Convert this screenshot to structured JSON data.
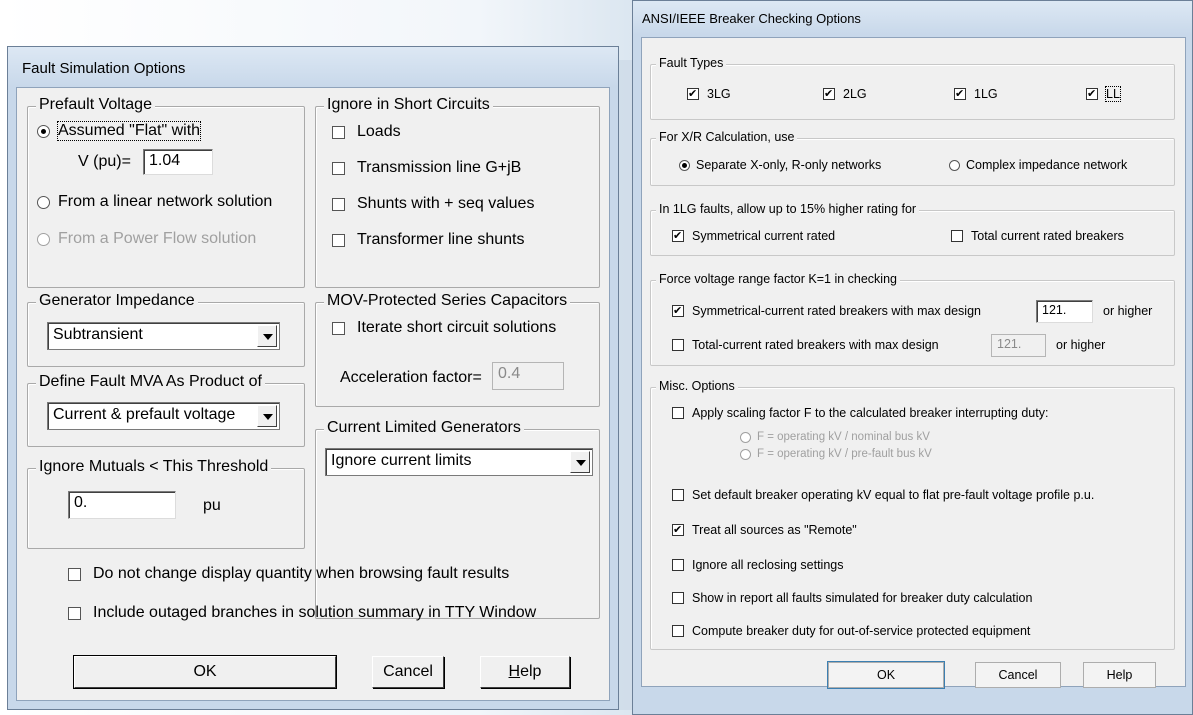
{
  "fault_sim": {
    "title": "Fault Simulation Options",
    "prefault": {
      "group": "Prefault Voltage",
      "assumed_flat": "Assumed \"Flat\" with",
      "vpu_label": "V (pu)=",
      "vpu_value": "1.04",
      "linear": "From a linear network solution",
      "powerflow": "From a Power Flow solution"
    },
    "ignore_sc": {
      "group": "Ignore in Short Circuits",
      "loads": "Loads",
      "trans_line": "Transmission line G+jB",
      "shunts": "Shunts with + seq values",
      "xfmr_shunts": "Transformer line shunts"
    },
    "gen_imp": {
      "group": "Generator Impedance",
      "value": "Subtransient"
    },
    "mov": {
      "group": "MOV-Protected Series Capacitors",
      "iterate": "Iterate short circuit solutions",
      "accel_label": "Acceleration factor=",
      "accel_value": "0.4"
    },
    "fault_mva": {
      "group": "Define Fault MVA As Product of",
      "value": "Current & prefault voltage"
    },
    "cur_lim": {
      "group": "Current Limited Generators",
      "value": "Ignore current limits"
    },
    "mutuals": {
      "group": "Ignore Mutuals < This Threshold",
      "value": "0.",
      "unit": "pu"
    },
    "no_change_display": "Do not change display quantity when browsing fault results",
    "include_outaged": "Include outaged branches in solution summary in TTY Window",
    "buttons": {
      "ok": "OK",
      "cancel": "Cancel",
      "help_h": "H",
      "help_rest": "elp"
    }
  },
  "breaker": {
    "title": "ANSI/IEEE Breaker Checking Options",
    "fault_types": {
      "group": "Fault Types",
      "t3lg": "3LG",
      "t2lg": "2LG",
      "t1lg": "1LG",
      "tll": "LL"
    },
    "xr": {
      "group": "For X/R Calculation, use",
      "separate": "Separate X-only, R-only networks",
      "complex": "Complex impedance network"
    },
    "one_lg": {
      "group": "In 1LG faults, allow up to 15% higher rating for",
      "sym": "Symmetrical current rated",
      "total": "Total current rated breakers"
    },
    "force_v": {
      "group": "Force voltage range factor K=1 in checking",
      "sym": "Symmetrical-current rated breakers with max design",
      "sym_value": "121.",
      "sym_suffix": "or higher",
      "total": "Total-current rated breakers with max design",
      "total_value": "121.",
      "total_suffix": "or higher"
    },
    "misc": {
      "group": "Misc. Options",
      "scaling": "Apply scaling factor F to the calculated breaker interrupting duty:",
      "f_nominal": "F = operating kV / nominal bus kV",
      "f_prefault": "F = operating kV / pre-fault bus kV",
      "set_default": "Set default breaker operating kV equal to flat pre-fault voltage profile p.u.",
      "remote": "Treat all sources as \"Remote\"",
      "reclosing": "Ignore all reclosing settings",
      "show_report": "Show in report all faults simulated for breaker duty calculation",
      "compute_oos": "Compute breaker duty for out-of-service protected equipment"
    },
    "buttons": {
      "ok": "OK",
      "cancel": "Cancel",
      "help": "Help"
    }
  }
}
